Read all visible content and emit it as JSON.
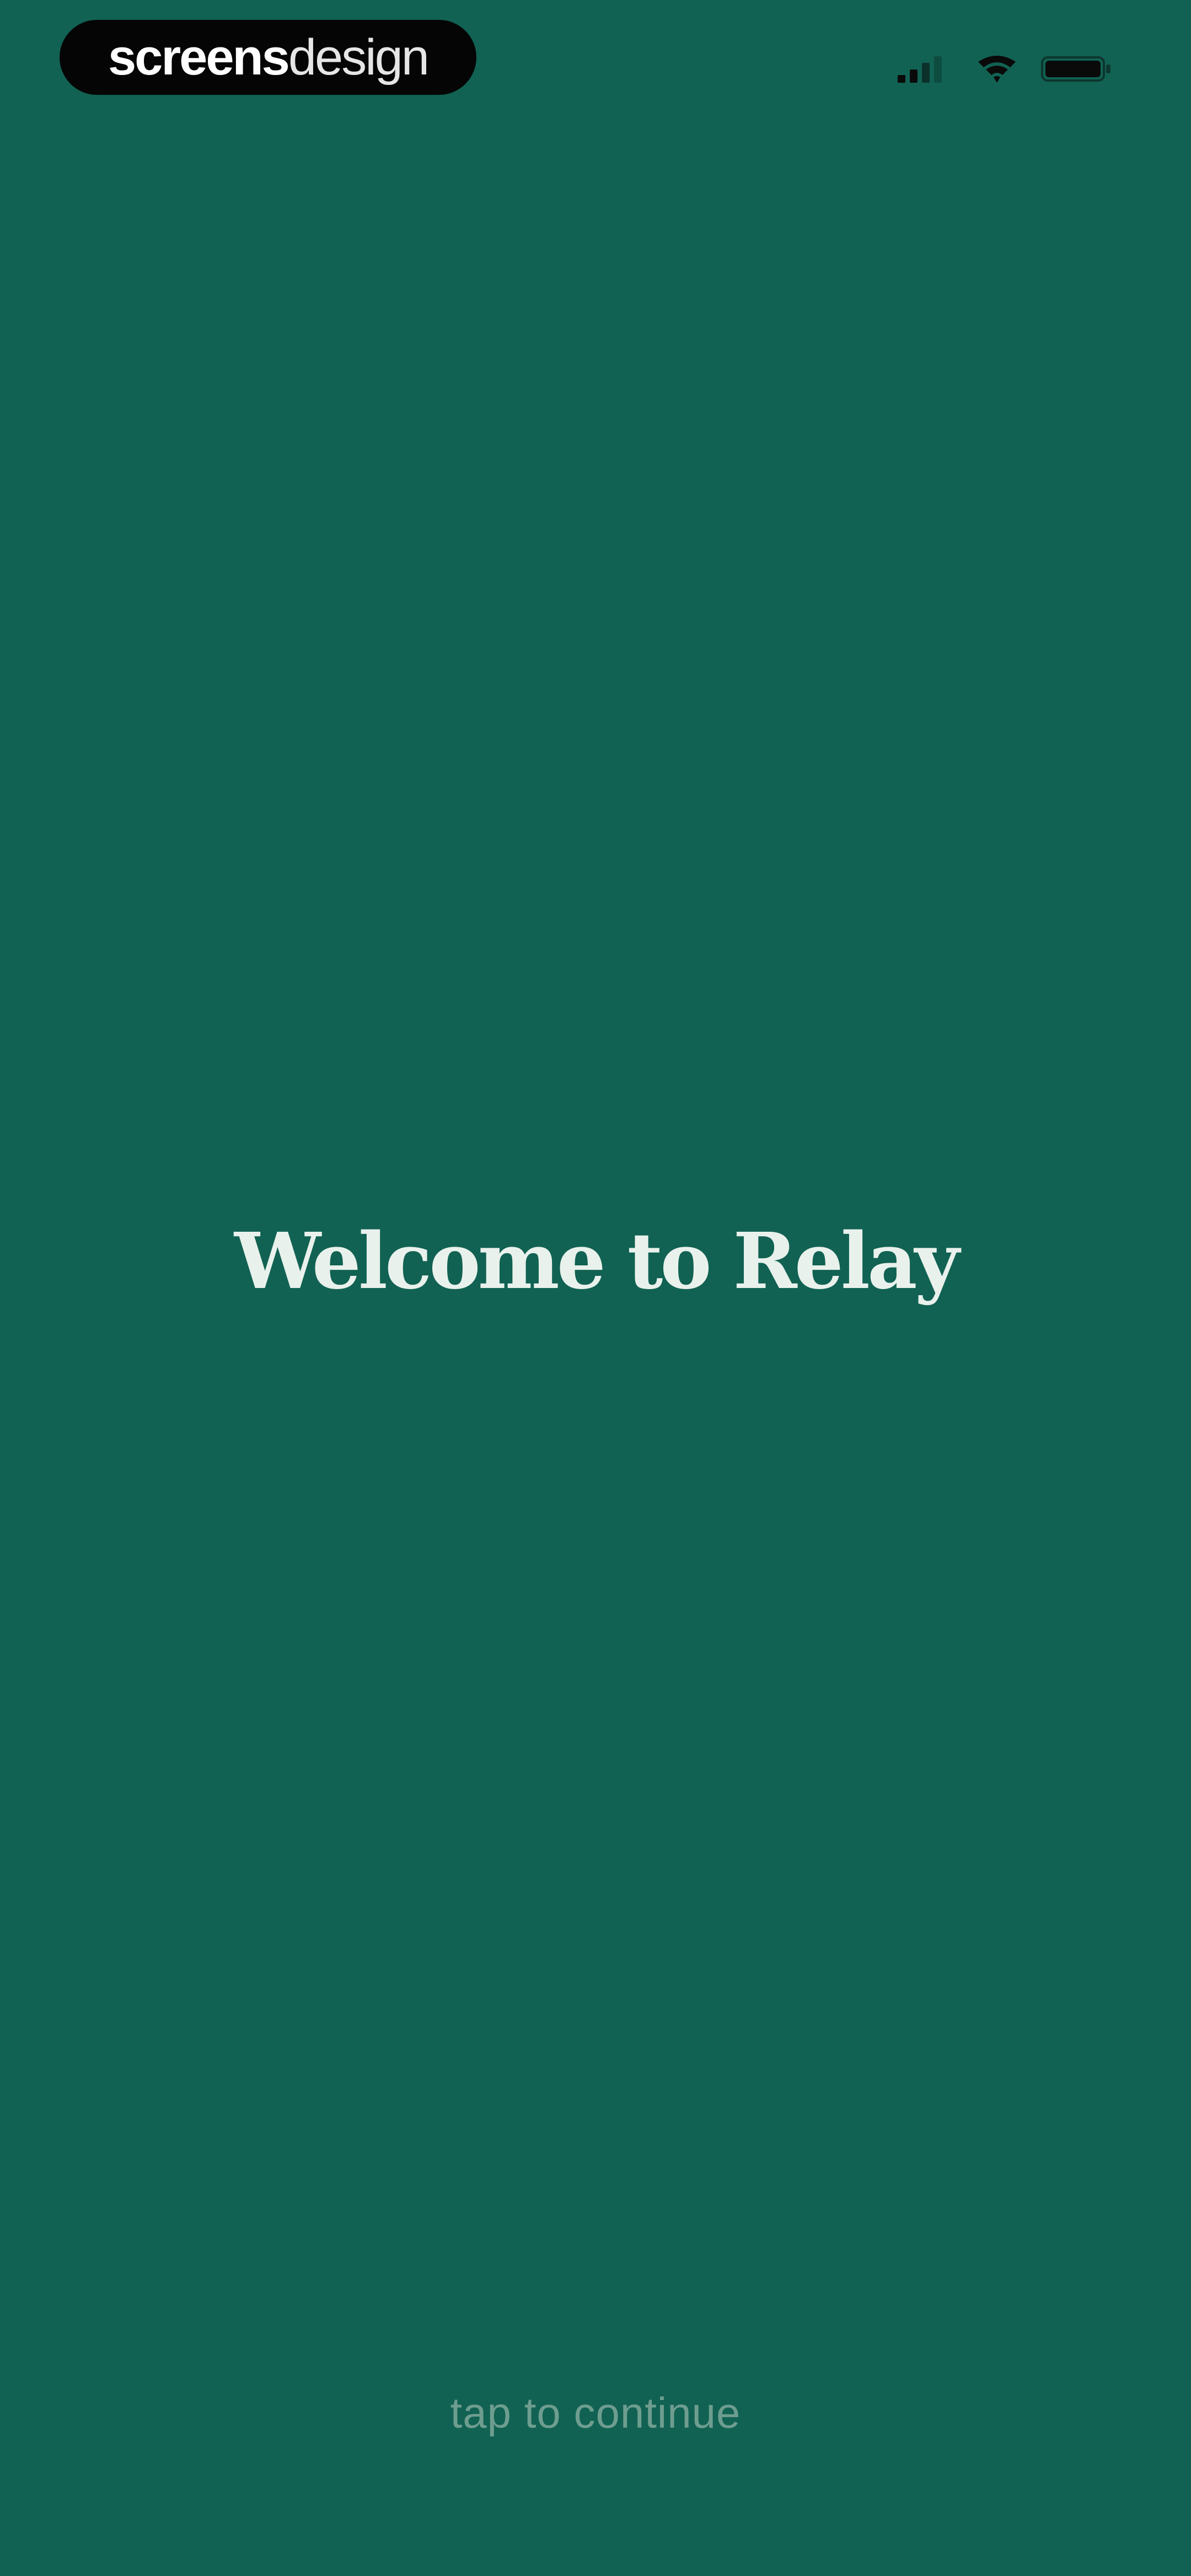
{
  "status_bar": {
    "brand_bold": "screens",
    "brand_light": "design",
    "icons": [
      "signal-icon",
      "wifi-icon",
      "battery-icon"
    ]
  },
  "main": {
    "title": "Welcome to Relay",
    "continue_hint": "tap to continue"
  },
  "colors": {
    "background": "#116252",
    "title": "#e9f1ec",
    "hint": "#6e9d90",
    "pill": "#050505"
  }
}
